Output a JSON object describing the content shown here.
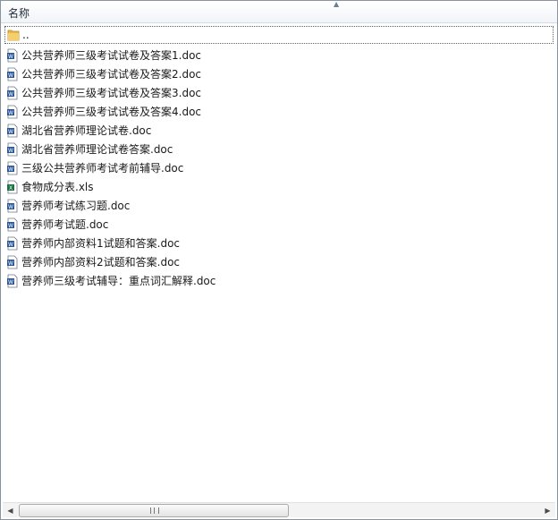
{
  "header": {
    "column_name": "名称"
  },
  "parent": {
    "label": ".."
  },
  "files": [
    {
      "name": "公共营养师三级考试试卷及答案1.doc",
      "type": "doc"
    },
    {
      "name": "公共营养师三级考试试卷及答案2.doc",
      "type": "doc"
    },
    {
      "name": "公共营养师三级考试试卷及答案3.doc",
      "type": "doc"
    },
    {
      "name": "公共营养师三级考试试卷及答案4.doc",
      "type": "doc"
    },
    {
      "name": "湖北省营养师理论试卷.doc",
      "type": "doc"
    },
    {
      "name": "湖北省营养师理论试卷答案.doc",
      "type": "doc"
    },
    {
      "name": "三级公共营养师考试考前辅导.doc",
      "type": "doc"
    },
    {
      "name": "食物成分表.xls",
      "type": "xls"
    },
    {
      "name": "营养师考试练习题.doc",
      "type": "doc"
    },
    {
      "name": "营养师考试题.doc",
      "type": "doc"
    },
    {
      "name": "营养师内部资料1试题和答案.doc",
      "type": "doc"
    },
    {
      "name": "营养师内部资料2试题和答案.doc",
      "type": "doc"
    },
    {
      "name": "营养师三级考试辅导：重点词汇解释.doc",
      "type": "doc"
    }
  ],
  "colors": {
    "doc_icon": "#2b5797",
    "xls_icon": "#1e7145",
    "folder": "#e8b84a"
  },
  "icons": {
    "doc": "word-doc-icon",
    "xls": "excel-xls-icon",
    "folder": "folder-icon"
  }
}
